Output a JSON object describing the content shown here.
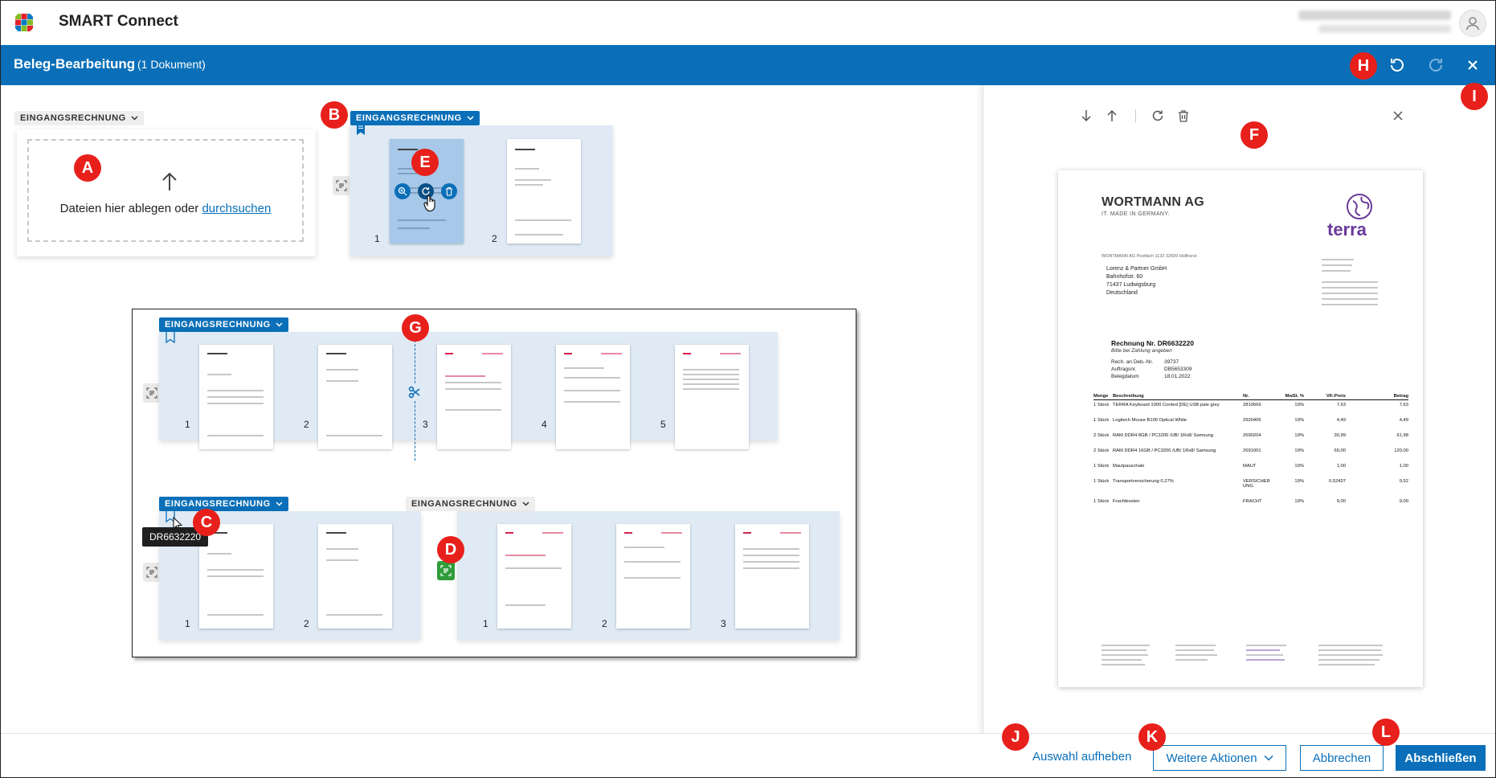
{
  "app": {
    "title": "SMART Connect"
  },
  "header": {
    "title": "Beleg-Bearbeitung",
    "count": "(1 Dokument)"
  },
  "doctype_label": "EINGANGSRECHNUNG",
  "upload": {
    "text": "Dateien hier ablegen oder",
    "link": "durchsuchen"
  },
  "groups": {
    "top_right": {
      "pages": [
        "1",
        "2"
      ]
    },
    "frame_row1": {
      "pages": [
        "1",
        "2",
        "3",
        "4",
        "5"
      ]
    },
    "frame_row2_left": {
      "pages": [
        "1",
        "2"
      ]
    },
    "frame_row2_right": {
      "pages": [
        "1",
        "2",
        "3"
      ]
    }
  },
  "tooltip": "DR6632220",
  "badges": [
    "A",
    "B",
    "C",
    "D",
    "E",
    "F",
    "G",
    "H",
    "I",
    "J",
    "K",
    "L"
  ],
  "preview": {
    "company": "WORTMANN AG",
    "slogan": "IT. MADE IN GERMANY.",
    "brand": "terra",
    "sender_line": "WORTMANN AG Postfach 1132 32609 Hüllhorst",
    "recipient": [
      "Lorenz & Partner GmbH",
      "Bahnhofstr. 60",
      "71437 Ludwigsburg",
      "Deutschland"
    ],
    "invoice_title": "Rechnung Nr. DR6632220",
    "invoice_sub": "Bitte bei Zahlung angeben",
    "meta": [
      {
        "k": "Rech. an Deb.-Nr.",
        "v": "39737"
      },
      {
        "k": "Auftragsnr.",
        "v": "DB5653309"
      },
      {
        "k": "Belegdatum",
        "v": "18.01.2022"
      }
    ],
    "columns": [
      "Menge",
      "Beschreibung",
      "Nr.",
      "MwSt. %",
      "VK-Preis",
      "Betrag"
    ],
    "rows": [
      {
        "qty": "1 Stück",
        "desc": "TERRA Keyboard 1000 Corded [DE] USB pale grey",
        "nr": "2810669",
        "vat": "19%",
        "price": "7,63",
        "total": "7,63"
      },
      {
        "qty": "1 Stück",
        "desc": "Logitech Mouse B100 Optical White",
        "nr": "2920406",
        "vat": "19%",
        "price": "4,49",
        "total": "4,49"
      },
      {
        "qty": "2 Stück",
        "desc": "RAM DDR4 8GB / PC3200 /UB/ 1Rx8/ Samsung",
        "nr": "2690204",
        "vat": "19%",
        "price": "30,99",
        "total": "61,98"
      },
      {
        "qty": "2 Stück",
        "desc": "RAM DDR4 16GB / PC3200 /UB/ 1Rx8/ Samsung",
        "nr": "2691001",
        "vat": "19%",
        "price": "60,00",
        "total": "120,00"
      },
      {
        "qty": "1 Stück",
        "desc": "Mautpauschale",
        "nr": "MAUT",
        "vat": "19%",
        "price": "1,00",
        "total": "1,00"
      },
      {
        "qty": "1 Stück",
        "desc": "Transportversicherung 0,27%",
        "nr": "VERSICHER UNG",
        "vat": "19%",
        "price": "0,52437",
        "total": "0,52"
      },
      {
        "qty": "1 Stück",
        "desc": "Frachtkosten",
        "nr": "FRACHT",
        "vat": "19%",
        "price": "9,00",
        "total": "9,00"
      }
    ]
  },
  "footer": {
    "clear_selection": "Auswahl aufheben",
    "more_actions": "Weitere Aktionen",
    "cancel": "Abbrechen",
    "finish": "Abschließen"
  },
  "colors": {
    "primary": "#0a6fb8",
    "badge": "#e8201b",
    "group_bg": "#dfeaf5",
    "ocr_green": "#2f9d3a",
    "terra_purple": "#6a3a9a"
  }
}
